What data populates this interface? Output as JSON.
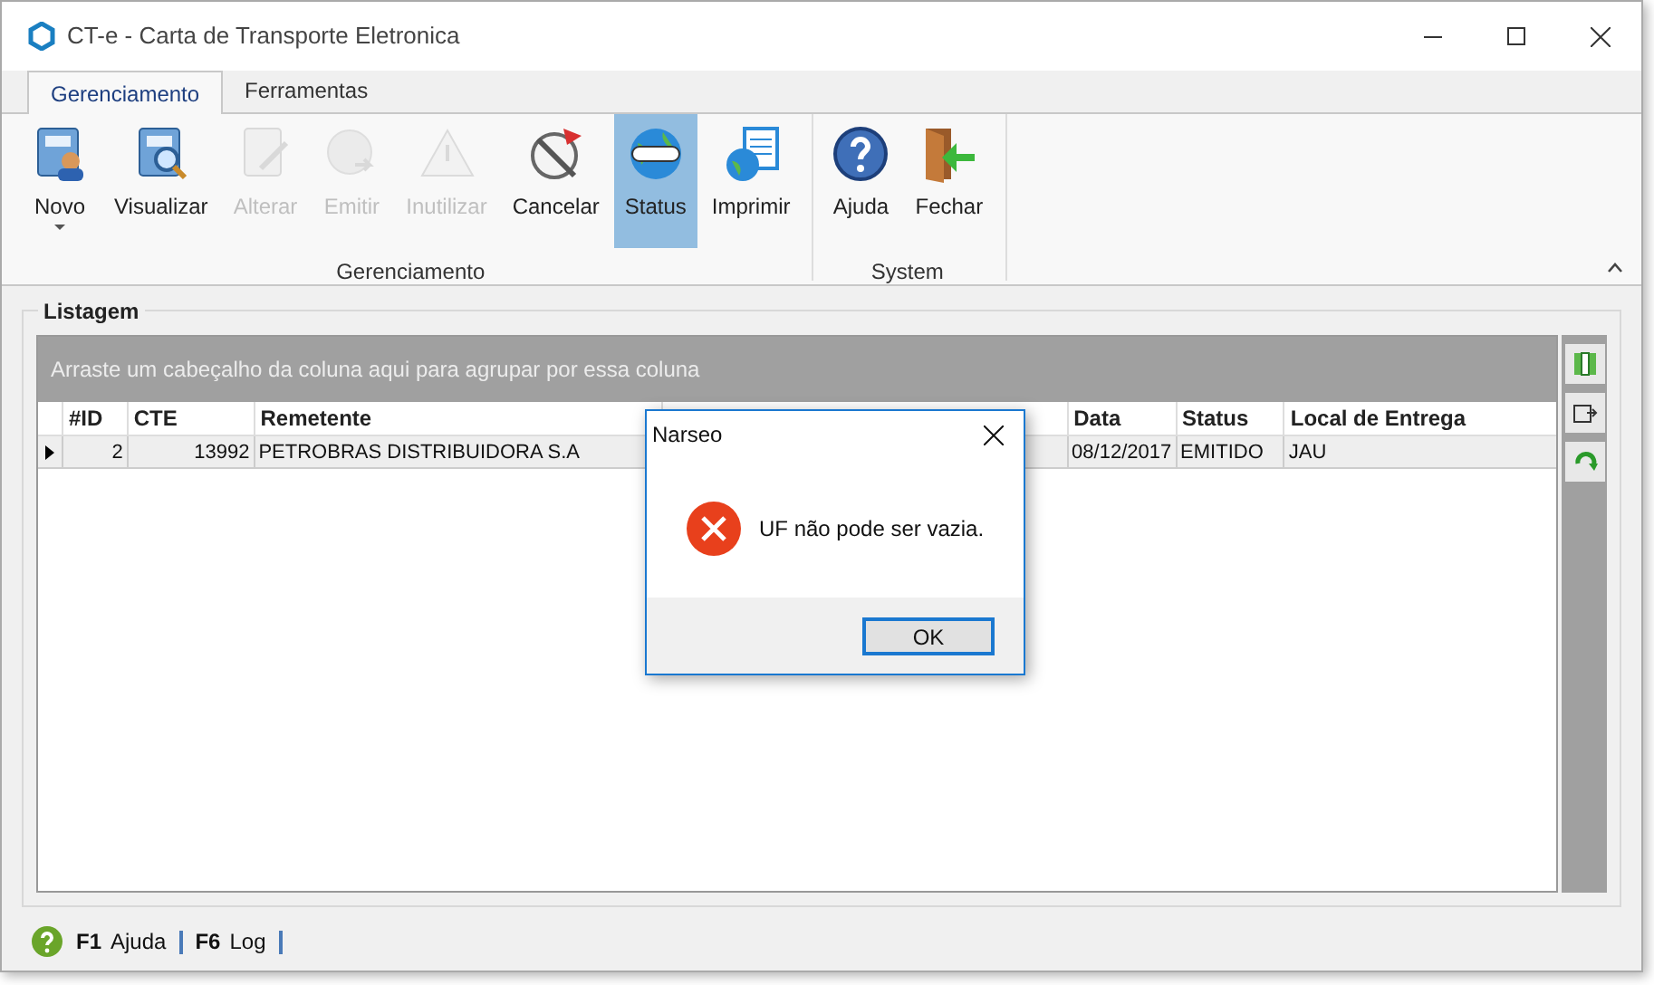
{
  "window": {
    "title": "CT-e - Carta de Transporte Eletronica"
  },
  "tabs": [
    {
      "label": "Gerenciamento",
      "selected": true
    },
    {
      "label": "Ferramentas",
      "selected": false
    }
  ],
  "ribbon": {
    "groups": [
      {
        "label": "Gerenciamento",
        "buttons": [
          {
            "label": "Novo",
            "disabled": false,
            "selected": false,
            "dropdown": true
          },
          {
            "label": "Visualizar",
            "disabled": false,
            "selected": false,
            "dropdown": false
          },
          {
            "label": "Alterar",
            "disabled": true,
            "selected": false,
            "dropdown": false
          },
          {
            "label": "Emitir",
            "disabled": true,
            "selected": false,
            "dropdown": false
          },
          {
            "label": "Inutilizar",
            "disabled": true,
            "selected": false,
            "dropdown": false
          },
          {
            "label": "Cancelar",
            "disabled": false,
            "selected": false,
            "dropdown": false
          },
          {
            "label": "Status",
            "disabled": false,
            "selected": true,
            "dropdown": false
          },
          {
            "label": "Imprimir",
            "disabled": false,
            "selected": false,
            "dropdown": false
          }
        ]
      },
      {
        "label": "System",
        "buttons": [
          {
            "label": "Ajuda",
            "disabled": false,
            "selected": false,
            "dropdown": false
          },
          {
            "label": "Fechar",
            "disabled": false,
            "selected": false,
            "dropdown": false
          }
        ]
      }
    ]
  },
  "listing": {
    "title": "Listagem",
    "group_hint": "Arraste um cabeçalho da coluna aqui para agrupar por essa coluna",
    "columns": [
      "#ID",
      "CTE",
      "Remetente",
      "",
      "Data",
      "Status",
      "Local de Entrega"
    ],
    "rows": [
      {
        "selected": true,
        "cells": [
          "2",
          "13992",
          "PETROBRAS DISTRIBUIDORA S.A",
          "",
          "08/12/2017",
          "EMITIDO",
          "JAU"
        ]
      }
    ]
  },
  "dialog": {
    "title": "Narseo",
    "message": "UF não pode ser vazia.",
    "button": "OK"
  },
  "status_bar": [
    {
      "key": "F1",
      "label": "Ajuda"
    },
    {
      "key": "F6",
      "label": "Log"
    }
  ]
}
